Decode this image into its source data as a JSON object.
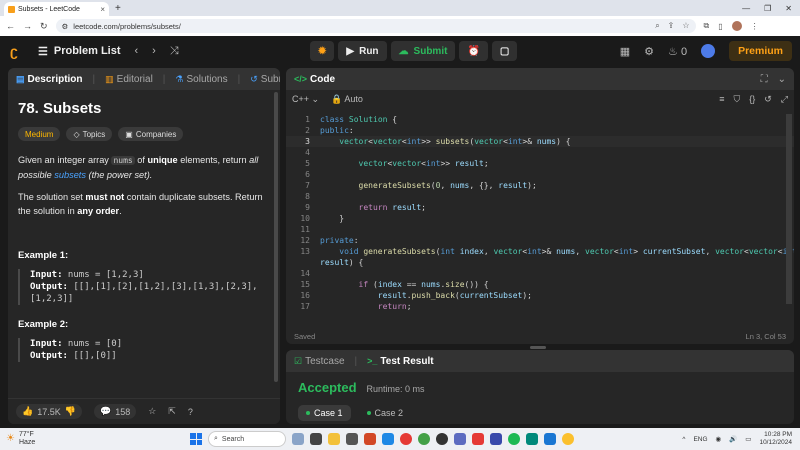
{
  "browser": {
    "tab_title": "Subsets - LeetCode",
    "url": "leetcode.com/problems/subsets/"
  },
  "nav": {
    "problem_list": "Problem List",
    "run": "Run",
    "submit": "Submit",
    "streak": "0",
    "premium": "Premium"
  },
  "left_tabs": [
    "Description",
    "Editorial",
    "Solutions",
    "Submissions"
  ],
  "problem": {
    "title": "78. Subsets",
    "difficulty": "Medium",
    "topics": "Topics",
    "companies": "Companies",
    "p1_a": "Given an integer array ",
    "p1_code": "nums",
    "p1_b": " of ",
    "p1_bold": "unique",
    "p1_c": " elements, return ",
    "p1_all": "all possible",
    "p1_link": "subsets",
    "p1_d": " (the power set).",
    "p2_a": "The solution set ",
    "p2_bold": "must not",
    "p2_b": " contain duplicate subsets. Return the solution in ",
    "p2_bold2": "any order",
    "p2_c": ".",
    "ex1_title": "Example 1:",
    "ex1_input_label": "Input:",
    "ex1_input": " nums = [1,2,3]",
    "ex1_output_label": "Output:",
    "ex1_output_a": " [[],[1],[2],[1,2],[3],[1,3],[2,3],",
    "ex1_output_b": "[1,2,3]]",
    "ex2_title": "Example 2:",
    "ex2_input_label": "Input:",
    "ex2_input": " nums = [0]",
    "ex2_output_label": "Output:",
    "ex2_output": " [[],[0]]"
  },
  "left_footer": {
    "likes": "17.5K",
    "comments": "158"
  },
  "code_panel": {
    "title": "Code",
    "language": "C++",
    "mode": "Auto",
    "saved": "Saved",
    "cursor": "Ln 3, Col 53"
  },
  "result_panel": {
    "tab_testcase": "Testcase",
    "tab_result": "Test Result",
    "status": "Accepted",
    "runtime": "Runtime: 0 ms",
    "case1": "Case 1",
    "case2": "Case 2"
  },
  "taskbar": {
    "temp": "77°F",
    "weather": "Haze",
    "search": "Search",
    "lang": "ENG",
    "time": "10:28 PM",
    "date": "10/12/2024"
  },
  "colors": {
    "accent_orange": "#ffa116",
    "accepted_green": "#2cbb5d",
    "panel_bg": "#262626"
  }
}
